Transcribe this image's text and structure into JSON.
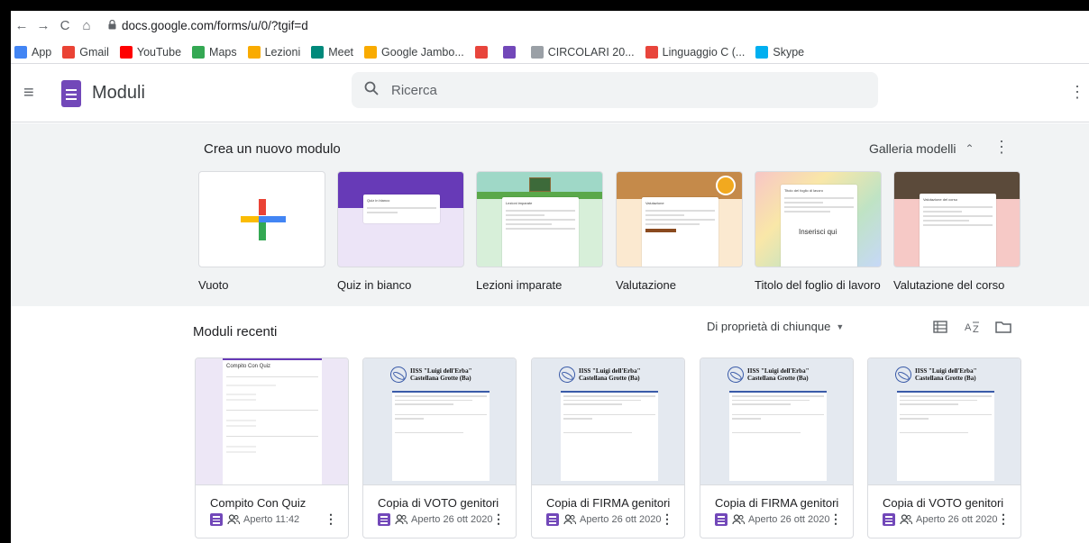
{
  "browser": {
    "url": "docs.google.com/forms/u/0/?tgif=d",
    "bookmarks": [
      {
        "label": "App",
        "icon": "apps-grid-icon",
        "color": "#4285f4"
      },
      {
        "label": "Gmail",
        "icon": "gmail-icon",
        "color": "#ea4335"
      },
      {
        "label": "YouTube",
        "icon": "youtube-icon",
        "color": "#ff0000"
      },
      {
        "label": "Maps",
        "icon": "maps-icon",
        "color": "#34a853"
      },
      {
        "label": "Lezioni",
        "icon": "classroom-icon",
        "color": "#f9ab00"
      },
      {
        "label": "Meet",
        "icon": "meet-icon",
        "color": "#00897b"
      },
      {
        "label": "Google Jambo...",
        "icon": "jamboard-icon",
        "color": "#f9ab00"
      },
      {
        "label": "",
        "icon": "is-icon",
        "color": "#e8453c"
      },
      {
        "label": "",
        "icon": "forms-icon",
        "color": "#7248b9"
      },
      {
        "label": "CIRCOLARI 20...",
        "icon": "school-icon",
        "color": "#9aa0a6"
      },
      {
        "label": "Linguaggio C (...",
        "icon": "ok-icon",
        "color": "#e8453c"
      },
      {
        "label": "Skype",
        "icon": "skype-icon",
        "color": "#00aff0"
      }
    ]
  },
  "header": {
    "app_title": "Moduli",
    "search_placeholder": "Ricerca"
  },
  "templates": {
    "title": "Crea un nuovo modulo",
    "gallery_label": "Galleria modelli",
    "items": [
      {
        "label": "Vuoto"
      },
      {
        "label": "Quiz in bianco",
        "thumb_title": "Quiz in bianco"
      },
      {
        "label": "Lezioni imparate",
        "thumb_title": "Lezioni imparate"
      },
      {
        "label": "Valutazione",
        "thumb_title": "Valutazione"
      },
      {
        "label": "Titolo del foglio di lavoro",
        "thumb_title": "Titolo del foglio di lavoro",
        "thumb_extra": "Inserisci qui"
      },
      {
        "label": "Valutazione del corso",
        "thumb_title": "Valutazione del corso"
      }
    ]
  },
  "recent": {
    "title": "Moduli recenti",
    "owner_filter": "Di proprietà di chiunque",
    "school_line1": "IISS \"Luigi dell'Erba\"",
    "school_line2": "Castellana Grotte (Ba)",
    "items": [
      {
        "name": "Compito Con Quiz",
        "meta": "Aperto 11:42",
        "thumb_title": "Compito Con Quiz"
      },
      {
        "name": "Copia di VOTO genitori",
        "meta": "Aperto 26 ott 2020"
      },
      {
        "name": "Copia di FIRMA genitori",
        "meta": "Aperto 26 ott 2020"
      },
      {
        "name": "Copia di FIRMA genitori",
        "meta": "Aperto 26 ott 2020"
      },
      {
        "name": "Copia di VOTO genitori",
        "meta": "Aperto 26 ott 2020"
      }
    ]
  },
  "colors": {
    "forms_purple": "#7248b9",
    "template_bg": "#f1f3f4"
  }
}
